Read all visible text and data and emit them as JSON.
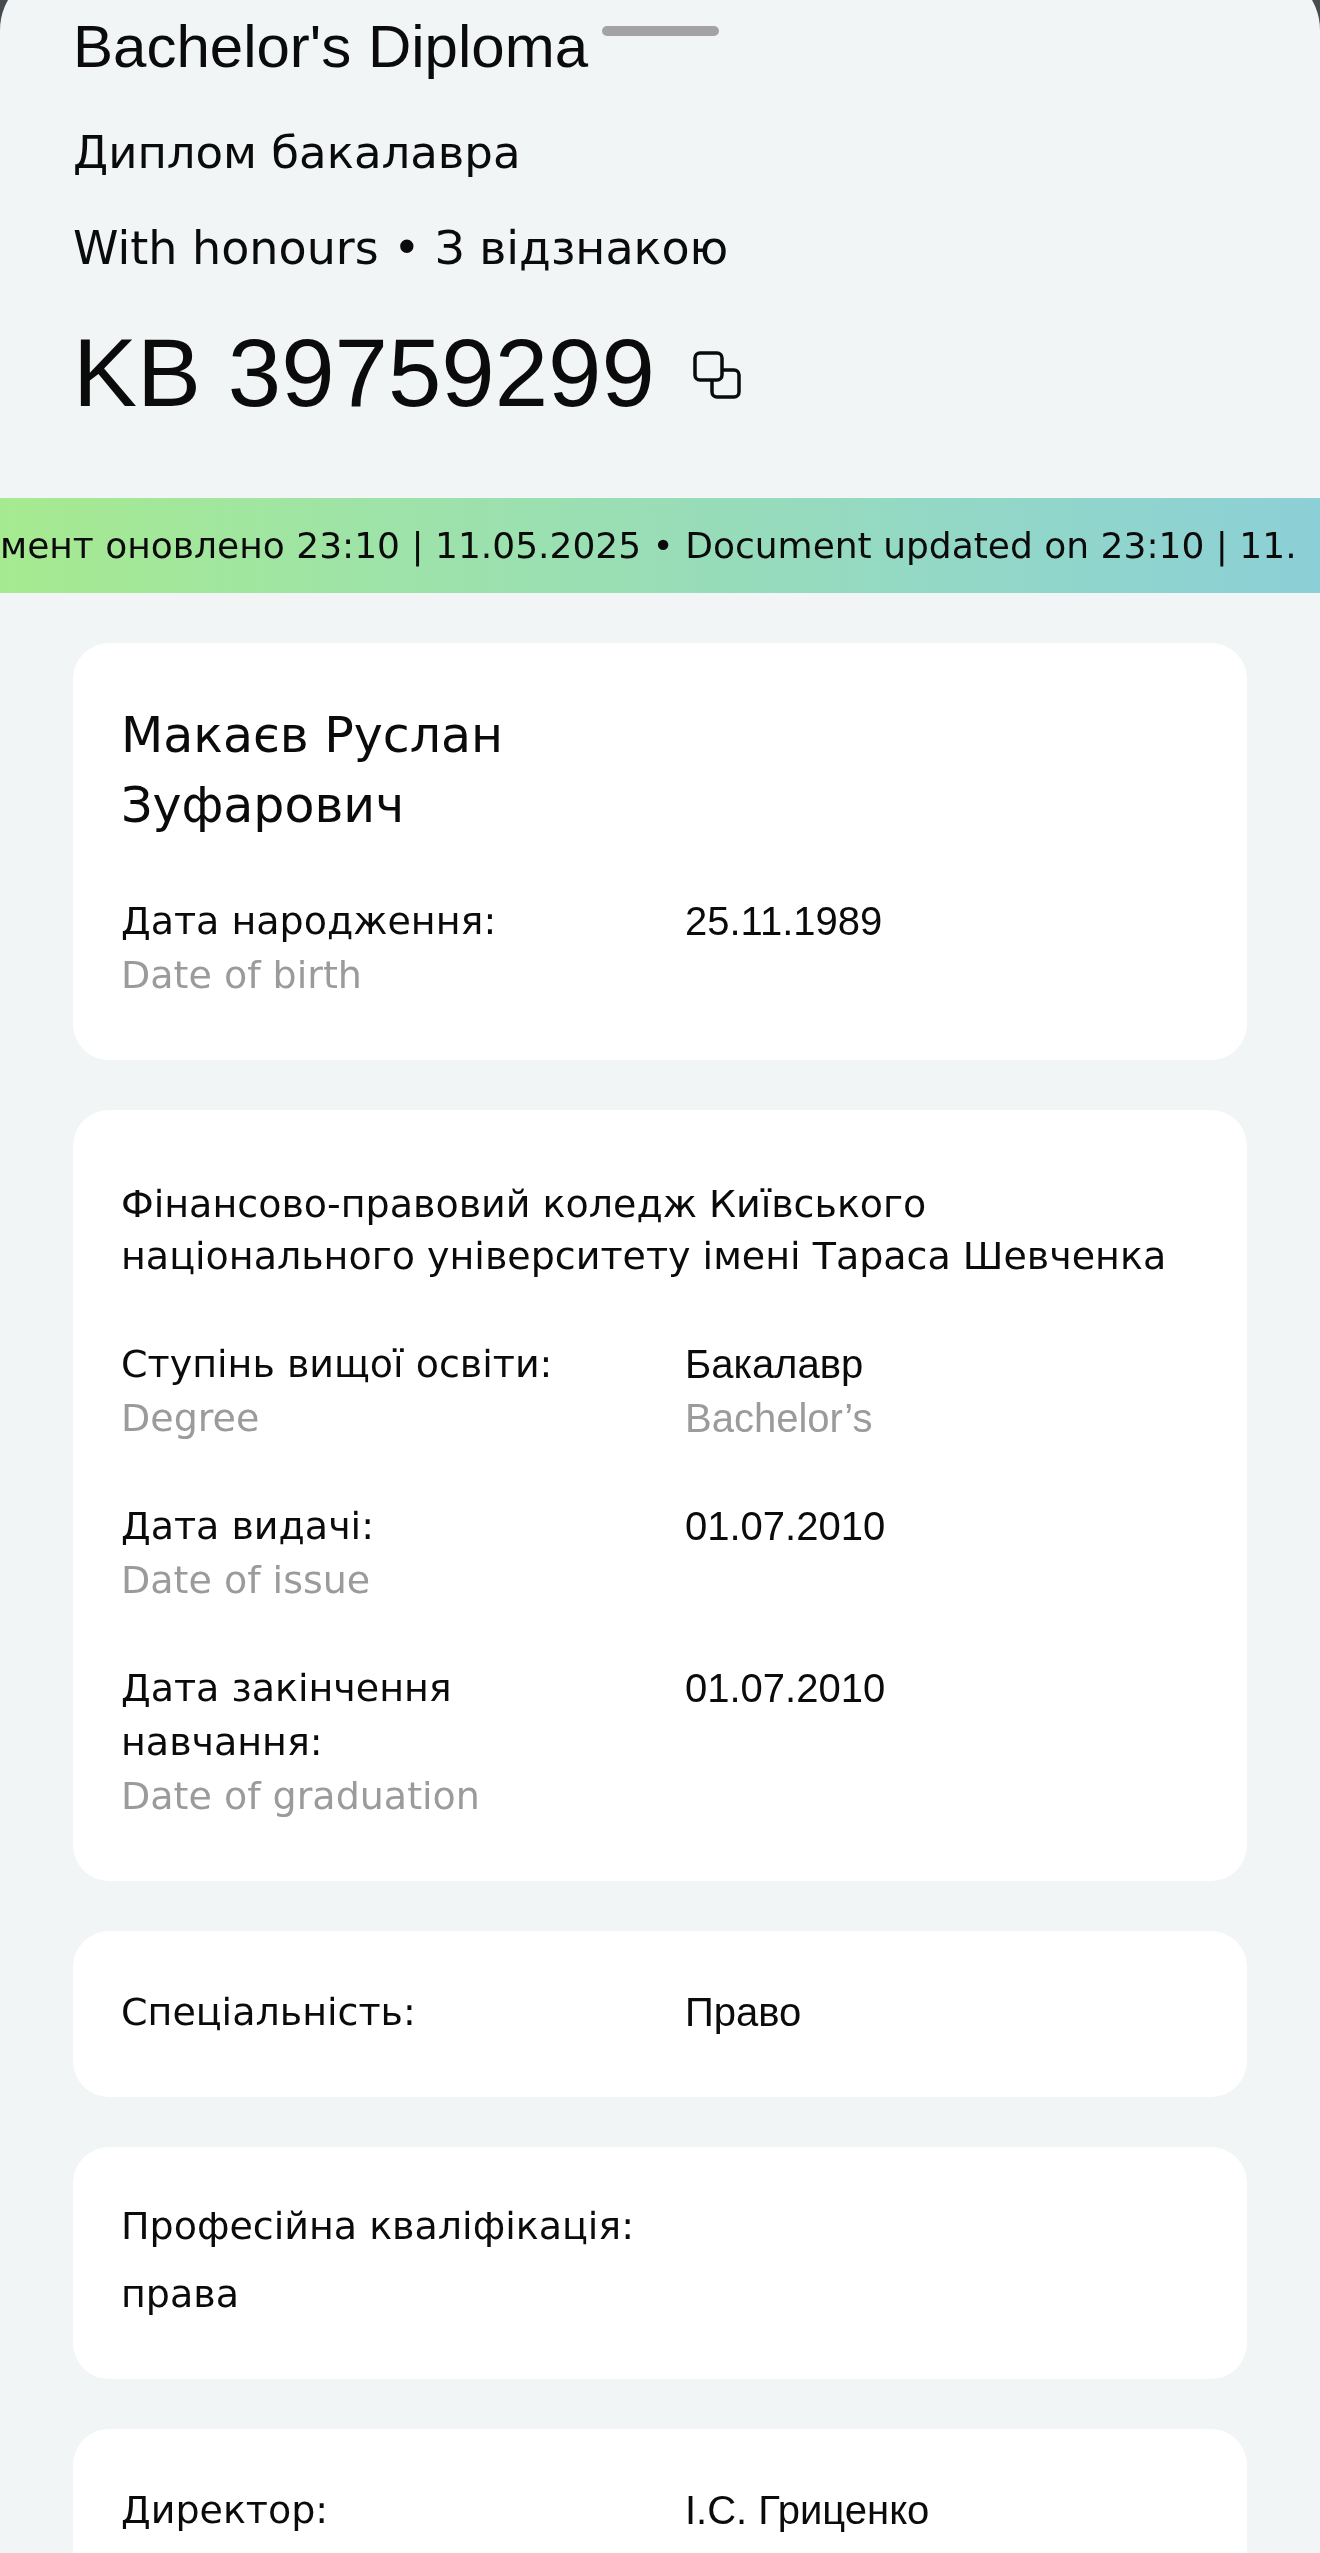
{
  "document": {
    "title": "Bachelor's Diploma",
    "subtitle": "Диплом бакалавра",
    "distinction": "With honours • З відзнакою",
    "number": "KB 39759299"
  },
  "update_banner": {
    "text": "мент оновлено 23:10 | 11.05.2025 • Document updated on 23:10 | 11."
  },
  "cards": [
    {
      "kind": "holder",
      "name": "Макаєв Руслан Зуфарович",
      "fields": [
        {
          "label": "Дата народження:",
          "label_en": "Date of birth",
          "value": "25.11.1989"
        }
      ]
    },
    {
      "kind": "institution",
      "institution": "Фінансово-правовий коледж Київського національного університету імені Тараса Шевченка",
      "fields": [
        {
          "label": "Ступінь вищої освіти:",
          "label_en": "Degree",
          "value": "Бакалавр",
          "value_en": "Bachelor’s"
        },
        {
          "label": "Дата видачі:",
          "label_en": "Date of issue",
          "value": "01.07.2010"
        },
        {
          "label": "Дата закінчення навчання:",
          "label_en": "Date of graduation",
          "value": "01.07.2010"
        }
      ]
    },
    {
      "kind": "fields",
      "fields": [
        {
          "label": "Спеціальність:",
          "value": "Право"
        }
      ]
    },
    {
      "kind": "stacked",
      "label": "Професійна кваліфікація:",
      "value": "права"
    },
    {
      "kind": "fields",
      "fields": [
        {
          "label": "Директор:",
          "value": "І.С. Гриценко"
        }
      ]
    }
  ]
}
